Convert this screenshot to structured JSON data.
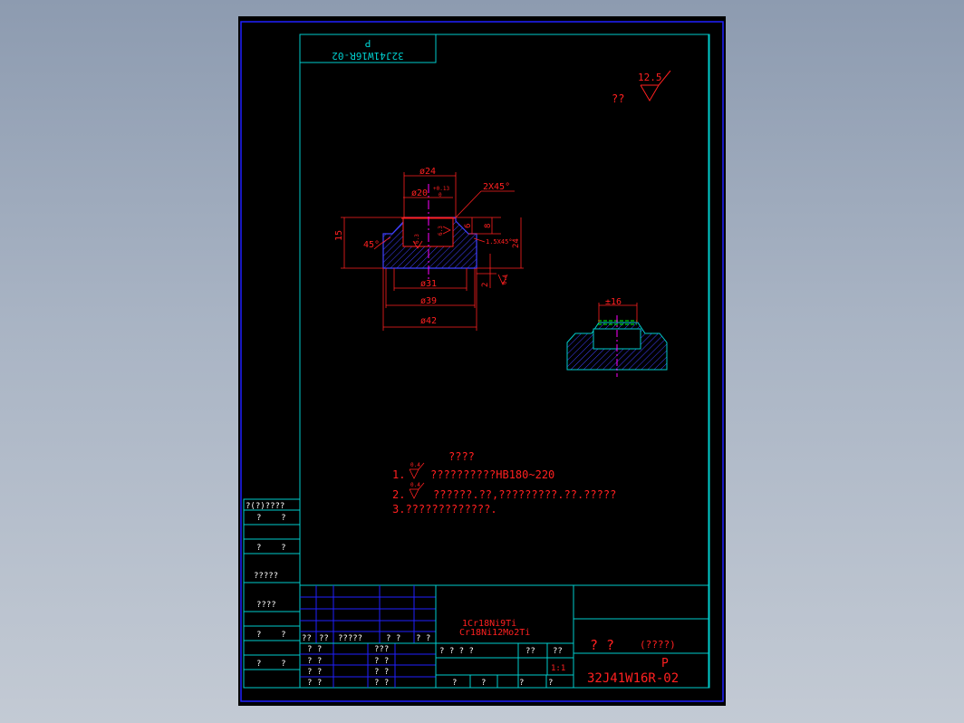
{
  "colors": {
    "background": "#9aa6b8",
    "sheet": "#000000",
    "border_blue": "#2020ff",
    "frame_cyan": "#00cccc",
    "dim_red": "#ff2020",
    "hatch_blue": "#4040ff",
    "center_magenta": "#ff00ff",
    "green": "#00ff00"
  },
  "drawing": {
    "top_block_code": "32J41W16R-02",
    "top_block_letter": "P",
    "roughness_note": "??",
    "roughness_value": "12.5"
  },
  "section_view": {
    "dim_d24": "ø24",
    "dim_d20": "ø20",
    "dim_d20_tol_upper": "+0.13",
    "dim_d20_tol_lower": "0",
    "dim_chamfer_top": "2X45°",
    "dim_height_15": "15",
    "dim_angle_45": "45°",
    "dim_6": "6",
    "dim_8": "8",
    "dim_chamfer_small": "1.5X45°",
    "dim_24_right": "24",
    "dim_2": "2",
    "rough_inner_left": "6.3",
    "rough_inner_right": "6.3",
    "rough_bottom": "0.4",
    "dim_d31": "ø31",
    "dim_d39": "ø39",
    "dim_d42": "ø42"
  },
  "side_view": {
    "dim_16": "±16"
  },
  "notes": {
    "title": "????",
    "line1_num": "1.",
    "line1_rough": "0.4",
    "line1_text": "??????????HB180~220",
    "line2_num": "2.",
    "line2_rough": "0.4",
    "line2_text": "??????.??,?????????.??.?????",
    "line3": "3.?????????????."
  },
  "left_strip": {
    "header": "?(?)????",
    "row1": "?    ?",
    "row2": "?    ?",
    "row3": "?????",
    "row4": "????",
    "row5": "?    ?",
    "row6": "?    ?"
  },
  "title_block": {
    "header_row": [
      "??",
      "??",
      "?????",
      "? ?",
      "? ?"
    ],
    "left_rows": [
      [
        "? ?",
        "???"
      ],
      [
        "? ?",
        "? ?"
      ],
      [
        "? ?",
        "? ?"
      ],
      [
        "? ?",
        "? ?"
      ]
    ],
    "material_line1": "1Cr18Ni9Ti",
    "material_line2": "Cr18Ni12Mo2Ti",
    "mid_row_labels": [
      "? ? ? ?",
      "??",
      "??"
    ],
    "scale": "1:1",
    "bottom_row": [
      "?",
      "?",
      "?",
      "?"
    ],
    "name_text": "? ?",
    "name_suffix": "(????)",
    "code_letter": "P",
    "code": "32J41W16R-02"
  }
}
